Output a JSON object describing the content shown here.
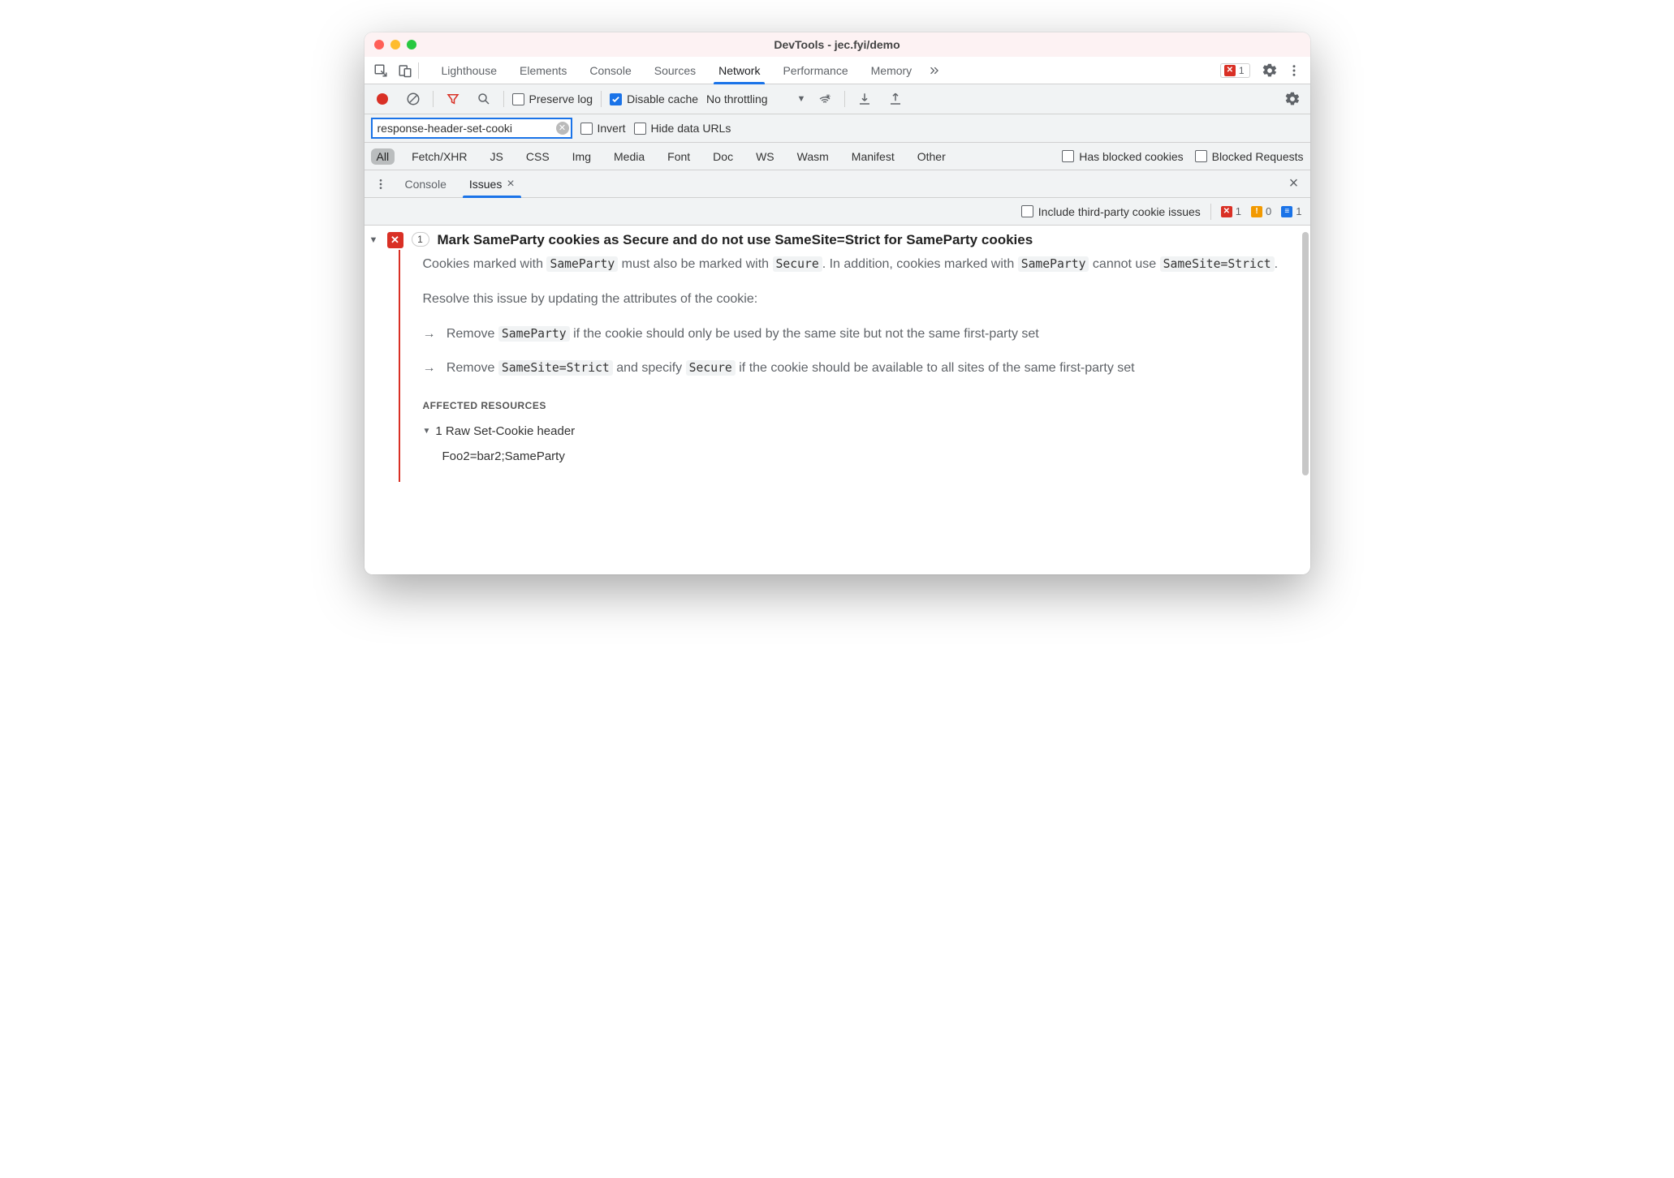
{
  "window": {
    "title": "DevTools - jec.fyi/demo"
  },
  "mainTabs": {
    "items": [
      "Lighthouse",
      "Elements",
      "Console",
      "Sources",
      "Network",
      "Performance",
      "Memory"
    ],
    "activeIndex": 4,
    "overflowIcon": "chevrons-right-icon",
    "errorCount": "1",
    "settingsIcon": "gear-icon",
    "moreIcon": "more-vertical-icon"
  },
  "netToolbar": {
    "preserveLog": {
      "label": "Preserve log",
      "checked": false
    },
    "disableCache": {
      "label": "Disable cache",
      "checked": true
    },
    "throttling": {
      "label": "No throttling"
    }
  },
  "filterBar": {
    "value": "response-header-set-cooki",
    "invert": {
      "label": "Invert",
      "checked": false
    },
    "hideDataUrls": {
      "label": "Hide data URLs",
      "checked": false
    }
  },
  "typeBar": {
    "types": [
      "All",
      "Fetch/XHR",
      "JS",
      "CSS",
      "Img",
      "Media",
      "Font",
      "Doc",
      "WS",
      "Wasm",
      "Manifest",
      "Other"
    ],
    "activeIndex": 0,
    "hasBlockedCookies": {
      "label": "Has blocked cookies",
      "checked": false
    },
    "blockedRequests": {
      "label": "Blocked Requests",
      "checked": false
    }
  },
  "drawer": {
    "tabs": [
      {
        "label": "Console",
        "active": false,
        "closable": false
      },
      {
        "label": "Issues",
        "active": true,
        "closable": true
      }
    ]
  },
  "issuesBar": {
    "includeThirdParty": {
      "label": "Include third-party cookie issues",
      "checked": false
    },
    "counts": {
      "error": "1",
      "warning": "0",
      "info": "1"
    }
  },
  "issue": {
    "count": "1",
    "title": "Mark SameParty cookies as Secure and do not use SameSite=Strict for SameParty cookies",
    "p1_a": "Cookies marked with ",
    "p1_code1": "SameParty",
    "p1_b": " must also be marked with ",
    "p1_code2": "Secure",
    "p1_c": ". In addition, cookies marked with ",
    "p1_code3": "SameParty",
    "p1_d": " cannot use ",
    "p1_code4": "SameSite=Strict",
    "p1_e": ".",
    "p2": "Resolve this issue by updating the attributes of the cookie:",
    "b1_a": "Remove ",
    "b1_code": "SameParty",
    "b1_b": " if the cookie should only be used by the same site but not the same first-party set",
    "b2_a": "Remove ",
    "b2_code1": "SameSite=Strict",
    "b2_b": " and specify ",
    "b2_code2": "Secure",
    "b2_c": " if the cookie should be available to all sites of the same first-party set",
    "affectedHeading": "AFFECTED RESOURCES",
    "affectedRow": "1 Raw Set-Cookie header",
    "affectedValue": "Foo2=bar2;SameParty"
  }
}
